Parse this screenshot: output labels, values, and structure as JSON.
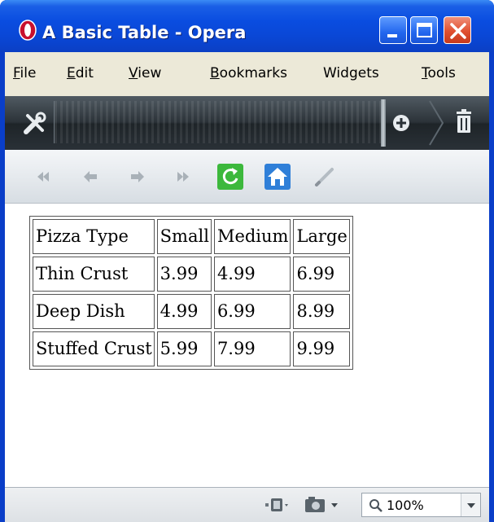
{
  "window": {
    "title": "A Basic Table - Opera"
  },
  "menubar": {
    "items": [
      {
        "mnemonic": "F",
        "rest": "ile"
      },
      {
        "mnemonic": "E",
        "rest": "dit"
      },
      {
        "mnemonic": "V",
        "rest": "iew"
      },
      {
        "mnemonic": "B",
        "rest": "ookmarks"
      },
      {
        "mnemonic": "",
        "rest": "Widgets"
      },
      {
        "mnemonic": "T",
        "rest": "ools"
      }
    ]
  },
  "toolbar_icons": {
    "customize": "tools-icon",
    "add": "add-icon",
    "trash": "trash-icon"
  },
  "navbar_icons": [
    "rewind-icon",
    "back-icon",
    "forward-icon",
    "fast-forward-icon",
    "reload-icon",
    "home-icon",
    "edit-icon"
  ],
  "table": {
    "rows": [
      [
        "Pizza Type",
        "Small",
        "Medium",
        "Large"
      ],
      [
        "Thin Crust",
        "3.99",
        "4.99",
        "6.99"
      ],
      [
        "Deep Dish",
        "4.99",
        "6.99",
        "8.99"
      ],
      [
        "Stuffed Crust",
        "5.99",
        "7.99",
        "9.99"
      ]
    ]
  },
  "statusbar": {
    "zoom": "100%"
  },
  "colors": {
    "titlebar": "#0a47d6",
    "close_button": "#e05030",
    "reload_green": "#3cb83c",
    "home_blue": "#2f7fd8"
  }
}
